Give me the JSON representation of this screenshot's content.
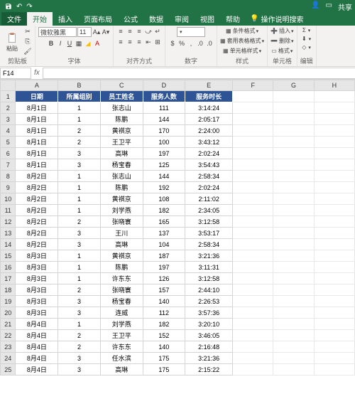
{
  "titlebar": {
    "save_tip": "保存",
    "share": "共享"
  },
  "menu": {
    "file": "文件",
    "home": "开始",
    "insert": "插入",
    "layout": "页面布局",
    "formulas": "公式",
    "data": "数据",
    "review": "审阅",
    "view": "视图",
    "help": "帮助",
    "tell": "操作说明搜索"
  },
  "ribbon": {
    "paste": "粘贴",
    "clipboard": "剪贴板",
    "font_name": "微软雅黑",
    "font_size": "11",
    "font_group": "字体",
    "align_group": "对齐方式",
    "number_group": "数字",
    "cond_fmt": "条件格式",
    "table_fmt": "套用表格格式",
    "cell_styles": "单元格样式",
    "styles_group": "样式",
    "insert_btn": "插入",
    "delete_btn": "删除",
    "format_btn": "格式",
    "cells_group": "单元格",
    "edit_group": "编辑"
  },
  "namebox": "F14",
  "cols": [
    "A",
    "B",
    "C",
    "D",
    "E",
    "F",
    "G",
    "H"
  ],
  "headers": [
    "日期",
    "所属组别",
    "员工姓名",
    "服务人数",
    "服务时长"
  ],
  "rows": [
    [
      "8月1日",
      "1",
      "张志山",
      "111",
      "3:14:24"
    ],
    [
      "8月1日",
      "1",
      "陈鹏",
      "144",
      "2:05:17"
    ],
    [
      "8月1日",
      "2",
      "黄褀京",
      "170",
      "2:24:00"
    ],
    [
      "8月1日",
      "2",
      "王卫平",
      "100",
      "3:43:12"
    ],
    [
      "8月1日",
      "3",
      "高琳",
      "197",
      "2:02:24"
    ],
    [
      "8月1日",
      "3",
      "杨宝春",
      "125",
      "3:54:43"
    ],
    [
      "8月2日",
      "1",
      "张志山",
      "144",
      "2:58:34"
    ],
    [
      "8月2日",
      "1",
      "陈鹏",
      "192",
      "2:02:24"
    ],
    [
      "8月2日",
      "1",
      "黄褀京",
      "108",
      "2:11:02"
    ],
    [
      "8月2日",
      "1",
      "刘学燕",
      "182",
      "2:34:05"
    ],
    [
      "8月2日",
      "2",
      "张晓寰",
      "165",
      "3:12:58"
    ],
    [
      "8月2日",
      "3",
      "王川",
      "137",
      "3:53:17"
    ],
    [
      "8月2日",
      "3",
      "高琳",
      "104",
      "2:58:34"
    ],
    [
      "8月3日",
      "1",
      "黄褀京",
      "187",
      "3:21:36"
    ],
    [
      "8月3日",
      "1",
      "陈鹏",
      "197",
      "3:11:31"
    ],
    [
      "8月3日",
      "1",
      "许东东",
      "126",
      "3:12:58"
    ],
    [
      "8月3日",
      "2",
      "张晓寰",
      "157",
      "2:44:10"
    ],
    [
      "8月3日",
      "3",
      "杨宝春",
      "140",
      "2:26:53"
    ],
    [
      "8月3日",
      "3",
      "连威",
      "112",
      "3:57:36"
    ],
    [
      "8月4日",
      "1",
      "刘学燕",
      "182",
      "3:20:10"
    ],
    [
      "8月4日",
      "2",
      "王卫平",
      "152",
      "3:46:05"
    ],
    [
      "8月4日",
      "2",
      "许东东",
      "140",
      "2:16:48"
    ],
    [
      "8月4日",
      "3",
      "任水滨",
      "175",
      "3:21:36"
    ],
    [
      "8月4日",
      "3",
      "高琳",
      "175",
      "2:15:22"
    ]
  ]
}
